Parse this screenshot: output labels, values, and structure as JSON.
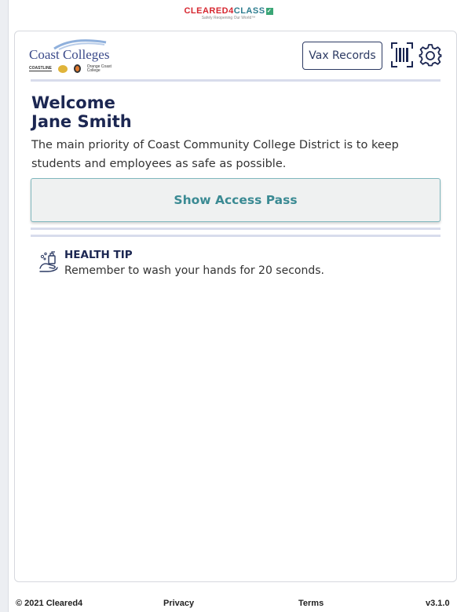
{
  "brand": {
    "name_part1": "CLEARED4",
    "name_part2": "CLASS",
    "tagline": "Safely Reopening Our World™"
  },
  "header": {
    "logo_title": "Coast Colleges",
    "logo_sub_left": "COASTLINE",
    "logo_sub_right": "Orange Coast College",
    "vax_records_label": "Vax Records"
  },
  "welcome": {
    "greeting": "Welcome",
    "user_name": "Jane Smith",
    "intro": "The main priority of Coast Community College District is to keep students and employees as safe as possible."
  },
  "access_pass": {
    "label": "Show Access Pass"
  },
  "health_tip": {
    "title": "HEALTH TIP",
    "text": "Remember to wash your hands for 20 seconds."
  },
  "footer": {
    "copyright": "© 2021 Cleared4",
    "privacy": "Privacy",
    "terms": "Terms",
    "version": "v3.1.0"
  },
  "colors": {
    "navy": "#1c2752",
    "teal": "#3a8a93",
    "brand_red": "#d6262f",
    "divider": "#d8dcec"
  },
  "icons": [
    "barcode-icon",
    "gear-icon",
    "hand-wash-icon",
    "check-icon"
  ]
}
